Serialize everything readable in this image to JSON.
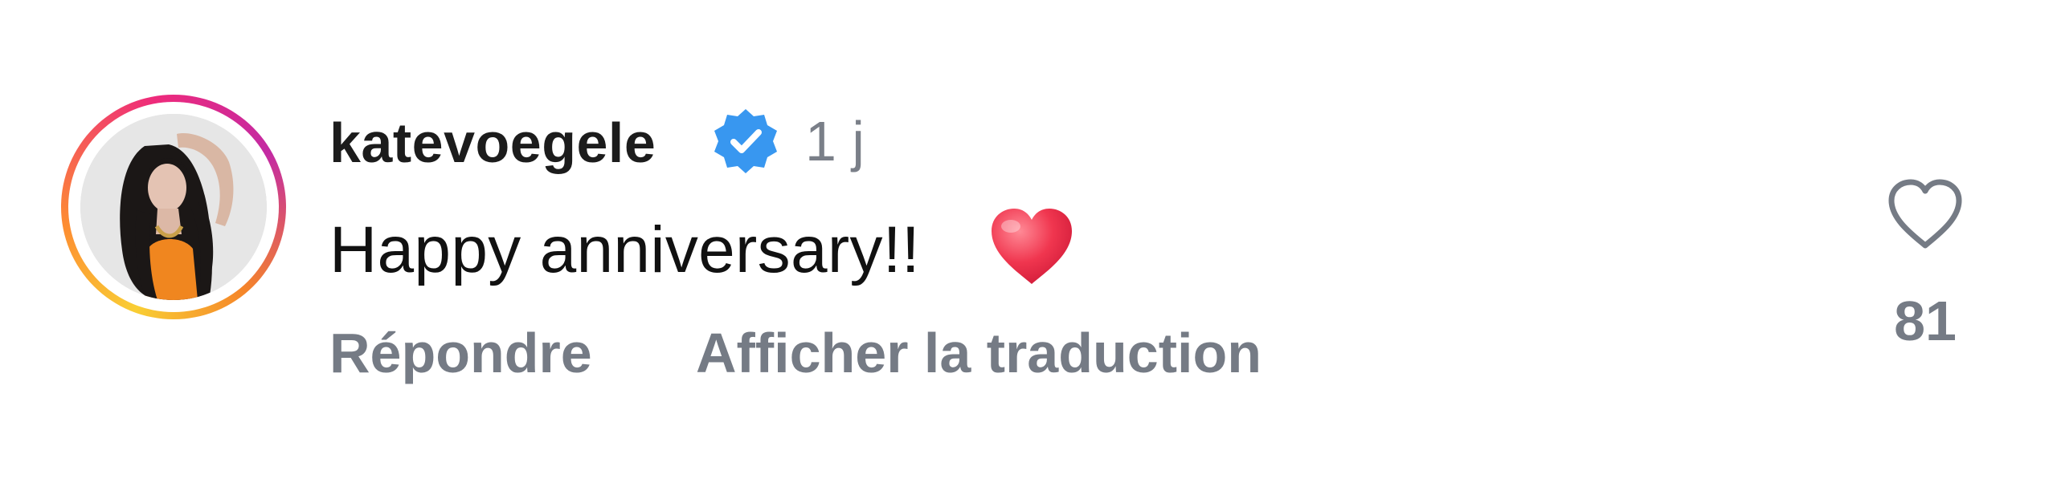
{
  "comment": {
    "username": "katevoegele",
    "verified": true,
    "timestamp": "1 j",
    "text": "Happy anniversary!!",
    "emoji": "red-heart",
    "reply_label": "Répondre",
    "translate_label": "Afficher la traduction",
    "like_count": "81",
    "like_icon": "heart-outline-icon",
    "verified_icon": "verified-badge-icon"
  },
  "colors": {
    "verified_blue": "#3897f0",
    "muted_text": "#757b85",
    "heart_red": "#f0364f"
  }
}
